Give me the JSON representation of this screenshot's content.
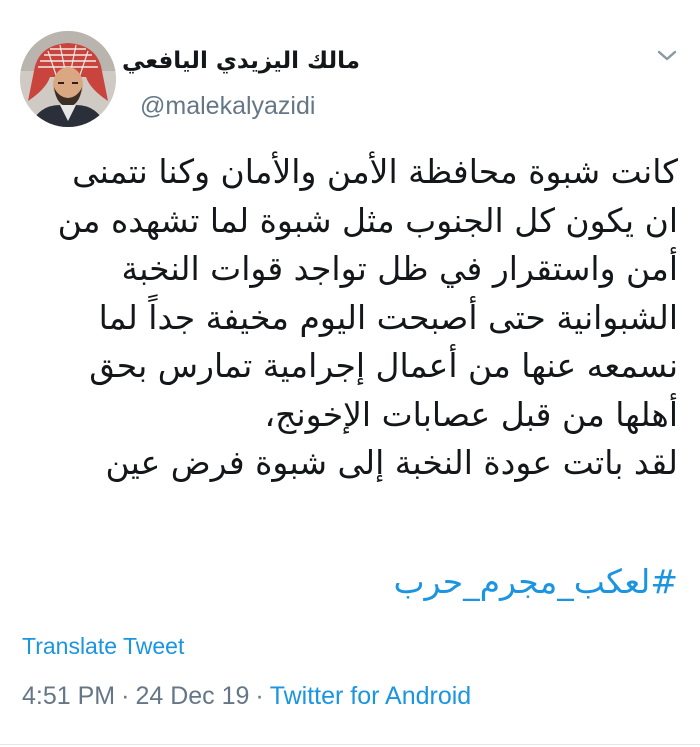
{
  "author": {
    "display_name": "مالك اليزيدي اليافعي",
    "handle": "@malekalyazidi",
    "avatar_icon": "profile-photo"
  },
  "menu_icon": "chevron-down-icon",
  "tweet": {
    "lines": [
      "كانت شبوة محافظة الأمن والأمان وكنا نتمنى",
      "ان يكون كل الجنوب مثل شبوة لما تشهده من",
      "أمن واستقرار في ظل تواجد قوات النخبة",
      "الشبوانية حتى أصبحت اليوم مخيفة جداً لما",
      "نسمعه عنها من أعمال إجرامية تمارس بحق",
      "أهلها من قبل عصابات الإخونج،",
      "لقد باتت عودة النخبة إلى شبوة فرض عين"
    ],
    "hashtag": "#لعكب_مجرم_حرب",
    "translate_label": "Translate Tweet",
    "time": "4:51 PM",
    "separator1": "·",
    "date": "24 Dec 19",
    "separator2": "·",
    "source": "Twitter for Android"
  },
  "colors": {
    "link": "#1b95e0",
    "secondary_text": "#657786",
    "primary_text": "#14171a"
  }
}
